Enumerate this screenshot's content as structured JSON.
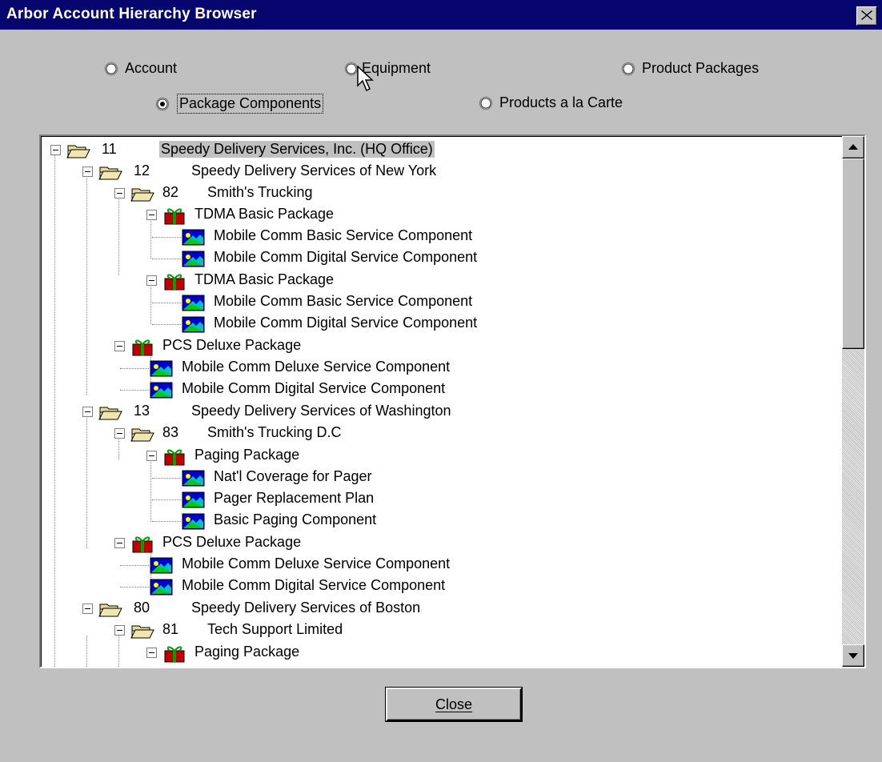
{
  "window": {
    "title": "Arbor Account Hierarchy Browser"
  },
  "options": [
    {
      "label": "Account",
      "selected": false
    },
    {
      "label": "Equipment",
      "selected": false
    },
    {
      "label": "Product Packages",
      "selected": false
    },
    {
      "label": "Package Components",
      "selected": true
    },
    {
      "label": "Products a la Carte",
      "selected": false
    }
  ],
  "tree": {
    "rows": [
      {
        "icon": "folder-icon",
        "num": "11",
        "name": "Speedy Delivery Services, Inc. (HQ Office)"
      },
      {
        "icon": "folder-icon",
        "num": "12",
        "name": "Speedy Delivery Services of New York"
      },
      {
        "icon": "folder-icon",
        "num": "82",
        "name": "Smith's Trucking"
      },
      {
        "icon": "gift-icon",
        "num": "",
        "name": "TDMA Basic Package"
      },
      {
        "icon": "component-icon",
        "num": "",
        "name": "Mobile Comm Basic Service Component"
      },
      {
        "icon": "component-icon",
        "num": "",
        "name": "Mobile Comm Digital Service Component"
      },
      {
        "icon": "gift-icon",
        "num": "",
        "name": "TDMA Basic Package"
      },
      {
        "icon": "component-icon",
        "num": "",
        "name": "Mobile Comm Basic Service Component"
      },
      {
        "icon": "component-icon",
        "num": "",
        "name": "Mobile Comm Digital Service Component"
      },
      {
        "icon": "gift-icon",
        "num": "",
        "name": "PCS Deluxe Package"
      },
      {
        "icon": "component-icon",
        "num": "",
        "name": "Mobile Comm Deluxe Service Component"
      },
      {
        "icon": "component-icon",
        "num": "",
        "name": "Mobile Comm Digital Service Component"
      },
      {
        "icon": "folder-icon",
        "num": "13",
        "name": "Speedy Delivery Services of Washington"
      },
      {
        "icon": "folder-icon",
        "num": "83",
        "name": "Smith's Trucking D.C"
      },
      {
        "icon": "gift-icon",
        "num": "",
        "name": "Paging Package"
      },
      {
        "icon": "component-icon",
        "num": "",
        "name": "Nat'l Coverage for Pager"
      },
      {
        "icon": "component-icon",
        "num": "",
        "name": "Pager Replacement Plan"
      },
      {
        "icon": "component-icon",
        "num": "",
        "name": "Basic Paging Component"
      },
      {
        "icon": "gift-icon",
        "num": "",
        "name": "PCS Deluxe Package"
      },
      {
        "icon": "component-icon",
        "num": "",
        "name": "Mobile Comm Deluxe Service Component"
      },
      {
        "icon": "component-icon",
        "num": "",
        "name": "Mobile Comm Digital Service Component"
      },
      {
        "icon": "folder-icon",
        "num": "80",
        "name": "Speedy Delivery Services of Boston"
      },
      {
        "icon": "folder-icon",
        "num": "81",
        "name": "Tech Support Limited"
      },
      {
        "icon": "gift-icon",
        "num": "",
        "name": "Paging Package"
      }
    ]
  },
  "buttons": {
    "close": "Close"
  }
}
